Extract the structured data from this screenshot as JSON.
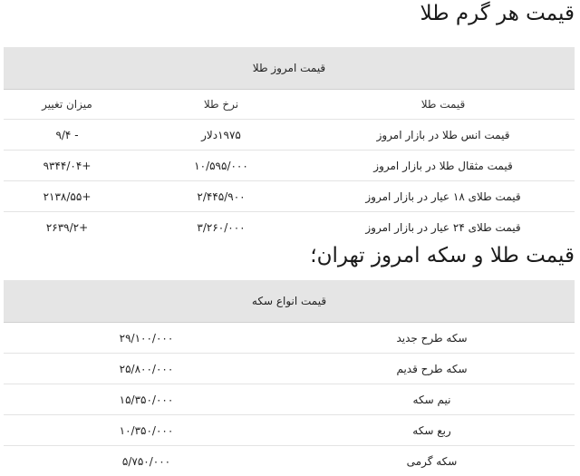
{
  "section1": {
    "title": "قیمت هر گرم طلا",
    "table_caption": "قیمت امروز طلا",
    "columns": [
      "قیمت طلا",
      "نرخ طلا",
      "میزان تغییر"
    ],
    "rows": [
      [
        "قیمت انس طلا در بازار امروز",
        "۱۹۷۵دلار",
        "- ۹/۴"
      ],
      [
        "قیمت مثقال طلا در بازار امروز",
        "۱۰/۵۹۵/۰۰۰",
        "+۹۳۴۴/۰۴"
      ],
      [
        "قیمت طلای ۱۸ عیار در بازار امروز",
        "۲/۴۴۵/۹۰۰",
        "+۲۱۳۸/۵۵"
      ],
      [
        "قیمت طلای ۲۴ عیار در بازار امروز",
        "۳/۲۶۰/۰۰۰",
        "+۲۶۳۹/۲"
      ]
    ]
  },
  "section2": {
    "title": "قیمت طلا و سکه امروز تهران؛",
    "table_caption": "قیمت انواع سکه",
    "rows": [
      [
        "سکه طرح جدید",
        "۲۹/۱۰۰/۰۰۰"
      ],
      [
        "سکه طرح قدیم",
        "۲۵/۸۰۰/۰۰۰"
      ],
      [
        "نیم سکه",
        "۱۵/۳۵۰/۰۰۰"
      ],
      [
        "ربع سکه",
        "۱۰/۳۵۰/۰۰۰"
      ],
      [
        "سکه گرمی",
        "۵/۷۵۰/۰۰۰"
      ]
    ]
  }
}
